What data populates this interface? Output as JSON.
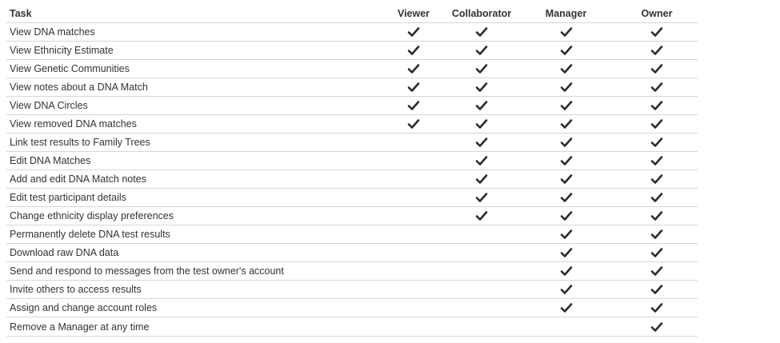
{
  "table": {
    "headers": [
      "Task",
      "Viewer",
      "Collaborator",
      "Manager",
      "Owner"
    ],
    "rows": [
      {
        "task": "View DNA matches",
        "perms": [
          true,
          true,
          true,
          true
        ]
      },
      {
        "task": "View Ethnicity Estimate",
        "perms": [
          true,
          true,
          true,
          true
        ]
      },
      {
        "task": "View Genetic Communities",
        "perms": [
          true,
          true,
          true,
          true
        ]
      },
      {
        "task": "View notes about a DNA Match",
        "perms": [
          true,
          true,
          true,
          true
        ]
      },
      {
        "task": "View DNA Circles",
        "perms": [
          true,
          true,
          true,
          true
        ]
      },
      {
        "task": "View removed DNA matches",
        "perms": [
          true,
          true,
          true,
          true
        ]
      },
      {
        "task": "Link test results to Family Trees",
        "perms": [
          false,
          true,
          true,
          true
        ]
      },
      {
        "task": "Edit DNA Matches",
        "perms": [
          false,
          true,
          true,
          true
        ]
      },
      {
        "task": "Add and edit DNA Match notes",
        "perms": [
          false,
          true,
          true,
          true
        ]
      },
      {
        "task": "Edit test participant details",
        "perms": [
          false,
          true,
          true,
          true
        ]
      },
      {
        "task": "Change ethnicity display preferences",
        "perms": [
          false,
          true,
          true,
          true
        ]
      },
      {
        "task": "Permanently delete DNA test results",
        "perms": [
          false,
          false,
          true,
          true
        ]
      },
      {
        "task": "Download raw DNA data",
        "perms": [
          false,
          false,
          true,
          true
        ]
      },
      {
        "task": "Send and respond to messages from the test owner's account",
        "perms": [
          false,
          false,
          true,
          true
        ]
      },
      {
        "task": "Invite others to access results",
        "perms": [
          false,
          false,
          true,
          true
        ]
      },
      {
        "task": "Assign and change account roles",
        "perms": [
          false,
          false,
          true,
          true
        ]
      },
      {
        "task": "Remove a Manager at any time",
        "perms": [
          false,
          false,
          false,
          true
        ]
      }
    ]
  },
  "icons": {
    "check": "checkmark-icon"
  },
  "colors": {
    "text": "#333333",
    "check": "#2b2b2b",
    "divider": "#d6d6d6"
  }
}
